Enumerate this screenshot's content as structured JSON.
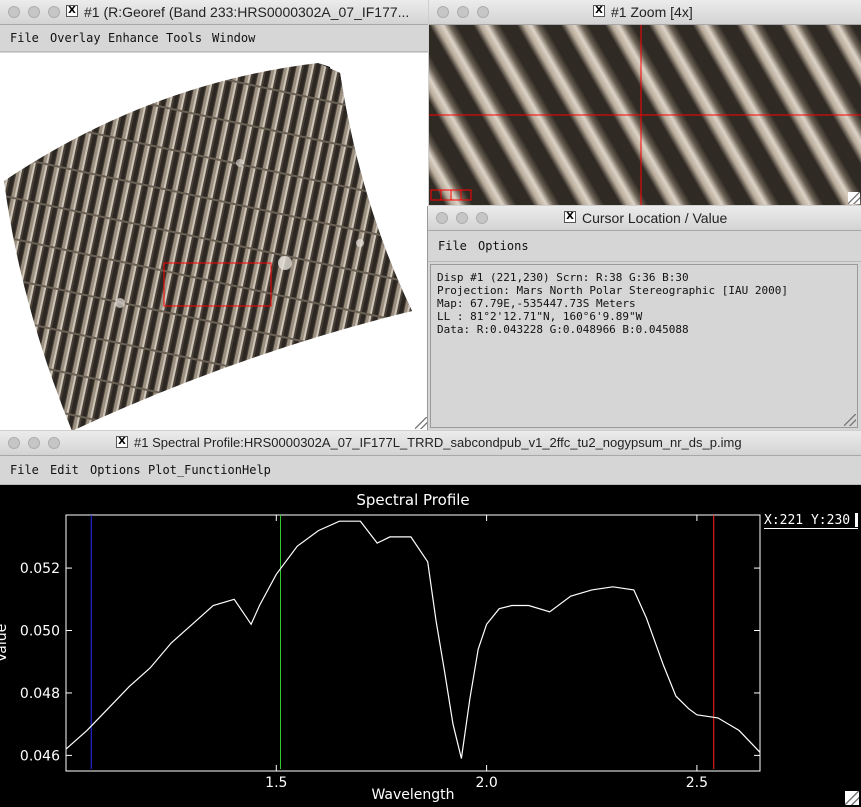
{
  "main_window": {
    "title": "#1 (R:Georef (Band 233:HRS0000302A_07_IF177...",
    "menu": [
      "File",
      "Overlay",
      "Enhance",
      "Tools",
      "Window"
    ]
  },
  "zoom_window": {
    "title": "#1 Zoom [4x]"
  },
  "cursor_window": {
    "title": "Cursor Location / Value",
    "menu": [
      "File",
      "Options"
    ],
    "lines": [
      "Disp #1 (221,230) Scrn: R:38 G:36 B:30",
      "Projection: Mars North Polar Stereographic [IAU 2000]",
      "Map: 67.79E,-535447.73S Meters",
      "LL : 81°2'12.71\"N, 160°6'9.89\"W",
      "Data: R:0.043228 G:0.048966 B:0.045088"
    ]
  },
  "spectral_window": {
    "title": "#1 Spectral Profile:HRS0000302A_07_IF177L_TRRD_sabcondpub_v1_2ffc_tu2_nogypsum_nr_ds_p.img",
    "menu": [
      "File",
      "Edit",
      "Options",
      "Plot_Function",
      "Help"
    ],
    "legend_label": "X:221 Y:230"
  },
  "colors": {
    "plot_bg": "#000000",
    "curve": "#ffffff",
    "marker_blue": "#2a2aff",
    "marker_green": "#33cc33",
    "marker_red": "#ff2222",
    "roi_box": "#ff0000"
  },
  "chart_data": {
    "type": "line",
    "title": "Spectral Profile",
    "xlabel": "Wavelength",
    "ylabel": "Value",
    "xlim": [
      1.0,
      2.65
    ],
    "ylim": [
      0.0455,
      0.0537
    ],
    "xticks": [
      1.5,
      2.0,
      2.5
    ],
    "xtick_labels": [
      "1.5",
      "2.0",
      "2.5"
    ],
    "yticks": [
      0.046,
      0.048,
      0.05,
      0.052
    ],
    "ytick_labels": [
      "0.046",
      "0.048",
      "0.050",
      "0.052"
    ],
    "grid": false,
    "markers": [
      {
        "x": 1.06,
        "color": "blue"
      },
      {
        "x": 1.51,
        "color": "green"
      },
      {
        "x": 2.54,
        "color": "red"
      }
    ],
    "series": [
      {
        "name": "X:221 Y:230",
        "x": [
          1.0,
          1.05,
          1.1,
          1.15,
          1.2,
          1.25,
          1.3,
          1.35,
          1.4,
          1.42,
          1.44,
          1.46,
          1.5,
          1.55,
          1.6,
          1.65,
          1.7,
          1.74,
          1.77,
          1.82,
          1.86,
          1.88,
          1.9,
          1.92,
          1.94,
          1.96,
          1.98,
          2.0,
          2.03,
          2.06,
          2.1,
          2.15,
          2.2,
          2.25,
          2.3,
          2.35,
          2.38,
          2.42,
          2.45,
          2.48,
          2.5,
          2.55,
          2.6,
          2.65
        ],
        "y": [
          0.0462,
          0.0468,
          0.0475,
          0.0482,
          0.0488,
          0.0496,
          0.0502,
          0.0508,
          0.051,
          0.0506,
          0.0502,
          0.0508,
          0.0518,
          0.0527,
          0.0532,
          0.0535,
          0.0535,
          0.0528,
          0.053,
          0.053,
          0.0522,
          0.0503,
          0.0487,
          0.047,
          0.0459,
          0.0478,
          0.0494,
          0.0502,
          0.0507,
          0.0508,
          0.0508,
          0.0506,
          0.0511,
          0.0513,
          0.0514,
          0.0513,
          0.0504,
          0.0489,
          0.0479,
          0.0475,
          0.0473,
          0.0472,
          0.0468,
          0.0461
        ]
      }
    ]
  }
}
